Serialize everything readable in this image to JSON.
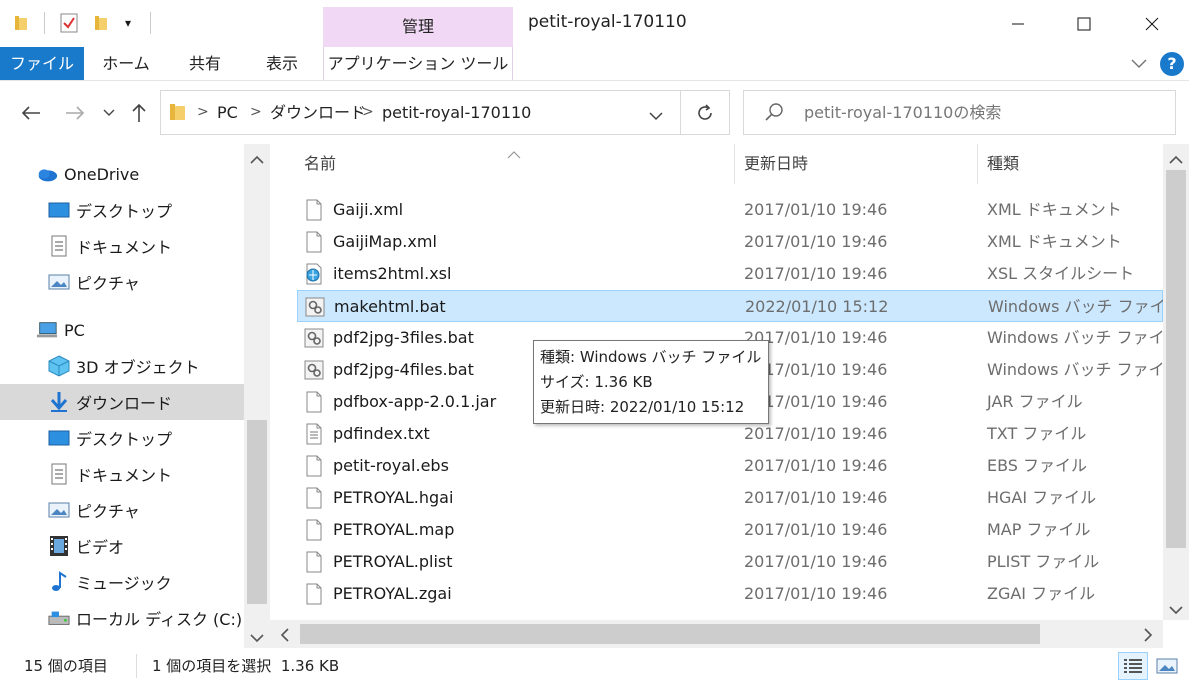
{
  "window": {
    "title": "petit-royal-170110",
    "manage_tab": "管理",
    "minimize": "—",
    "maximize": "☐",
    "close": "✕"
  },
  "ribbon": {
    "tabs": [
      "ファイル",
      "ホーム",
      "共有",
      "表示",
      "アプリケーション ツール"
    ],
    "help": "?"
  },
  "address": {
    "crumbs": [
      "PC",
      "ダウンロード",
      "petit-royal-170110"
    ],
    "search_placeholder": "petit-royal-170110の検索"
  },
  "nav": {
    "items": [
      {
        "label": "OneDrive",
        "icon": "cloud-icon"
      },
      {
        "label": "デスクトップ",
        "icon": "desktop-icon"
      },
      {
        "label": "ドキュメント",
        "icon": "document-icon"
      },
      {
        "label": "ピクチャ",
        "icon": "picture-icon"
      },
      {
        "label": "PC",
        "icon": "pc-icon"
      },
      {
        "label": "3D オブジェクト",
        "icon": "cube-icon"
      },
      {
        "label": "ダウンロード",
        "icon": "download-icon"
      },
      {
        "label": "デスクトップ",
        "icon": "desktop-icon"
      },
      {
        "label": "ドキュメント",
        "icon": "document-icon"
      },
      {
        "label": "ピクチャ",
        "icon": "picture-icon"
      },
      {
        "label": "ビデオ",
        "icon": "video-icon"
      },
      {
        "label": "ミュージック",
        "icon": "music-icon"
      },
      {
        "label": "ローカル ディスク (C:)",
        "icon": "disk-icon"
      }
    ]
  },
  "list": {
    "columns": [
      "名前",
      "更新日時",
      "種類"
    ],
    "rows": [
      {
        "name": "Gaiji.xml",
        "date": "2017/01/10 19:46",
        "type": "XML ドキュメント",
        "icon": "file-icon"
      },
      {
        "name": "GaijiMap.xml",
        "date": "2017/01/10 19:46",
        "type": "XML ドキュメント",
        "icon": "file-icon"
      },
      {
        "name": "items2html.xsl",
        "date": "2017/01/10 19:46",
        "type": "XSL スタイルシート",
        "icon": "xsl-icon"
      },
      {
        "name": "makehtml.bat",
        "date": "2022/01/10 15:12",
        "type": "Windows バッチ ファイル",
        "icon": "batch-icon"
      },
      {
        "name": "pdf2jpg-3files.bat",
        "date": "2017/01/10 19:46",
        "type": "Windows バッチ ファイル",
        "icon": "batch-icon"
      },
      {
        "name": "pdf2jpg-4files.bat",
        "date": "2017/01/10 19:46",
        "type": "Windows バッチ ファイル",
        "icon": "batch-icon"
      },
      {
        "name": "pdfbox-app-2.0.1.jar",
        "date": "2017/01/10 19:46",
        "type": "JAR ファイル",
        "icon": "file-icon"
      },
      {
        "name": "pdfindex.txt",
        "date": "2017/01/10 19:46",
        "type": "TXT ファイル",
        "icon": "text-file-icon"
      },
      {
        "name": "petit-royal.ebs",
        "date": "2017/01/10 19:46",
        "type": "EBS ファイル",
        "icon": "file-icon"
      },
      {
        "name": "PETROYAL.hgai",
        "date": "2017/01/10 19:46",
        "type": "HGAI ファイル",
        "icon": "file-icon"
      },
      {
        "name": "PETROYAL.map",
        "date": "2017/01/10 19:46",
        "type": "MAP ファイル",
        "icon": "file-icon"
      },
      {
        "name": "PETROYAL.plist",
        "date": "2017/01/10 19:46",
        "type": "PLIST ファイル",
        "icon": "file-icon"
      },
      {
        "name": "PETROYAL.zgai",
        "date": "2017/01/10 19:46",
        "type": "ZGAI ファイル",
        "icon": "file-icon"
      }
    ],
    "selected_index": 3
  },
  "tooltip": {
    "line1": "種類: Windows バッチ ファイル",
    "line2": "サイズ: 1.36 KB",
    "line3": "更新日時: 2022/01/10 15:12"
  },
  "status": {
    "count": "15 個の項目",
    "selected": "1 個の項目を選択  1.36 KB"
  },
  "colors": {
    "accent": "#1979ca",
    "selection": "#cce8ff",
    "manage_tab": "#f1d9f5"
  }
}
